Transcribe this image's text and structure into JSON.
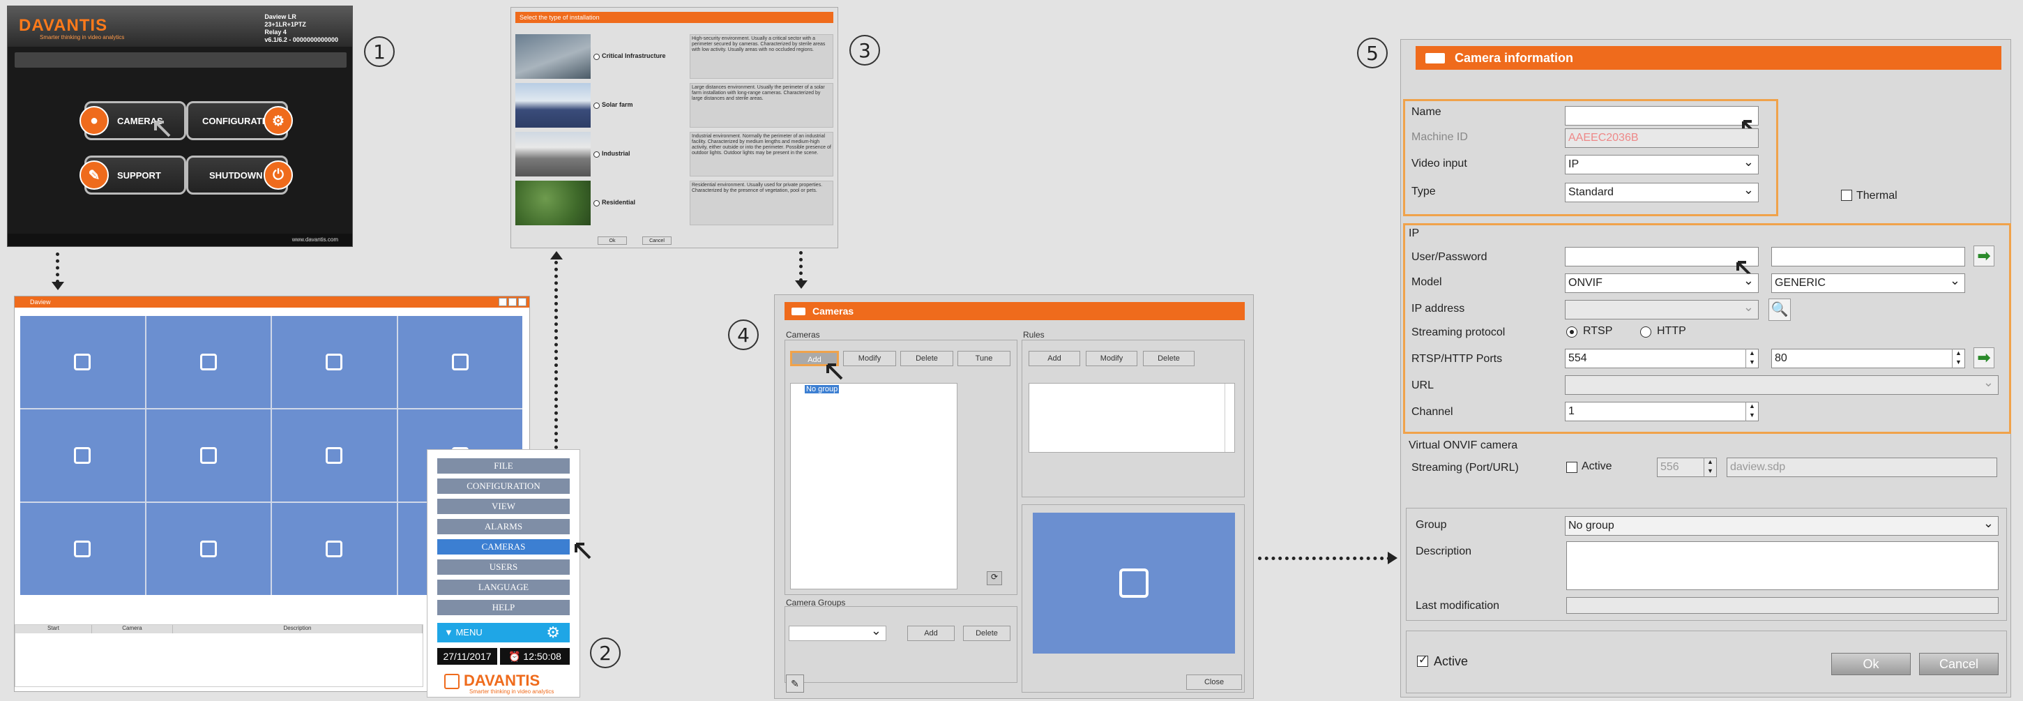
{
  "steps": [
    "1",
    "2",
    "3",
    "4",
    "5"
  ],
  "panel1": {
    "logo": "DAVANTIS",
    "logo_sub": "Smarter thinking in video analytics",
    "info": "Daview LR\n23+1LR+1PTZ\nRelay 4\nv6.1/6.2 - 0000000000000",
    "buttons": [
      "CAMERAS",
      "CONFIGURATION",
      "SUPPORT",
      "SHUTDOWN"
    ],
    "footer": "www.davantis.com"
  },
  "panel2": {
    "title": "Daview",
    "table_headers": [
      "Start",
      "Camera",
      "Description"
    ]
  },
  "menu": {
    "items": [
      "FILE",
      "CONFIGURATION",
      "VIEW",
      "ALARMS",
      "CAMERAS",
      "USERS",
      "LANGUAGE",
      "HELP"
    ],
    "active": "CAMERAS",
    "menu_label": "▼ MENU",
    "date": "27/11/2017",
    "time": "12:50:08",
    "logo": "DAVANTIS",
    "logo_sub": "Smarter thinking in video analytics"
  },
  "panel3": {
    "title": "Select the type of installation",
    "options": [
      {
        "label": "Critical Infrastructure",
        "desc": "High-security environment.\nUsually a critical sector with a perimeter secured by cameras.\nCharacterized by sterile areas with low activity. Usually areas with no occluded regions."
      },
      {
        "label": "Solar farm",
        "desc": "Large distances environment.\nUsually the perimeter of a solar farm installation with long-range cameras. Characterized by large distances and sterile areas."
      },
      {
        "label": "Industrial",
        "desc": "Industrial environment.\nNormally the perimeter of an industrial facility. Characterized by medium lengths and medium-high activity, either outside or into the perimeter. Possible presence of outdoor lights. Outdoor lights may be present in the scene."
      },
      {
        "label": "Residential",
        "desc": "Residential environment.\nUsually used for private properties. Characterized by the presence of vegetation, pool or pets."
      }
    ],
    "ok": "Ok",
    "cancel": "Cancel"
  },
  "panel4": {
    "title": "Cameras",
    "cameras_group": "Cameras",
    "rules_group": "Rules",
    "camera_groups": "Camera Groups",
    "cam_buttons": [
      "Add",
      "Modify",
      "Delete",
      "Tune"
    ],
    "rule_buttons": [
      "Add",
      "Modify",
      "Delete"
    ],
    "group_buttons": [
      "Add",
      "Delete"
    ],
    "tree_item": "No group",
    "close": "Close"
  },
  "panel5": {
    "title": "Camera information",
    "name_label": "Name",
    "machine_id_label": "Machine ID",
    "machine_id": "AAEEC2036B",
    "video_input_label": "Video input",
    "video_input": "IP",
    "type_label": "Type",
    "type": "Standard",
    "thermal": "Thermal",
    "ip_section": "IP",
    "user_password_label": "User/Password",
    "model_label": "Model",
    "model": "ONVIF",
    "model2": "GENERIC",
    "ip_address_label": "IP address",
    "streaming_protocol_label": "Streaming protocol",
    "rtsp": "RTSP",
    "http": "HTTP",
    "ports_label": "RTSP/HTTP Ports",
    "port1": "554",
    "port2": "80",
    "url_label": "URL",
    "channel_label": "Channel",
    "channel": "1",
    "virtual_section": "Virtual ONVIF camera",
    "streaming_label": "Streaming (Port/URL)",
    "active_small": "Active",
    "stream_port": "556",
    "stream_url": "daview.sdp",
    "group_label": "Group",
    "group": "No group",
    "description_label": "Description",
    "last_mod_label": "Last modification",
    "active": "Active",
    "ok": "Ok",
    "cancel": "Cancel"
  },
  "colors": {
    "accent": "#ef6b1c",
    "highlight": "#f0a24a",
    "tile": "#6b8fd0",
    "menu_item": "#7f8ea6",
    "menu_active": "#3c7fd2",
    "menu_bar": "#1fa6e6"
  }
}
